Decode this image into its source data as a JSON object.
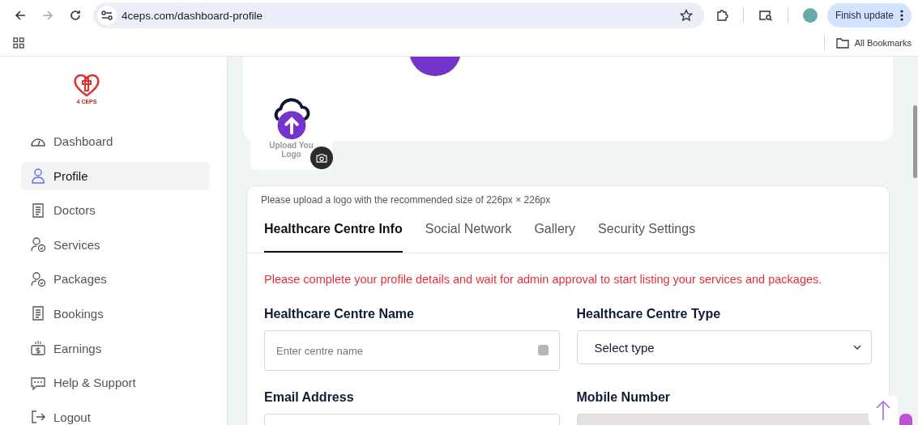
{
  "browser": {
    "url": "4ceps.com/dashboard-profile",
    "update_button": "Finish update",
    "bookmarks": "All Bookmarks"
  },
  "sidebar": {
    "logo_text": "4 CEPS",
    "items": [
      {
        "label": "Dashboard",
        "kind": "gauge",
        "selected": false
      },
      {
        "label": "Profile",
        "kind": "user",
        "selected": true
      },
      {
        "label": "Doctors",
        "kind": "doc",
        "selected": false
      },
      {
        "label": "Services",
        "kind": "usercheck",
        "selected": false
      },
      {
        "label": "Packages",
        "kind": "usercheck",
        "selected": false
      },
      {
        "label": "Bookings",
        "kind": "doc",
        "selected": false
      },
      {
        "label": "Earnings",
        "kind": "money",
        "selected": false
      },
      {
        "label": "Help & Support",
        "kind": "chat",
        "selected": false
      },
      {
        "label": "Logout",
        "kind": "logout",
        "selected": false
      }
    ]
  },
  "upload": {
    "label": "Upload You\nLogo"
  },
  "form": {
    "hint": "Please upload a logo with the recommended size of 226px × 226px",
    "tabs": [
      {
        "label": "Healthcare Centre Info",
        "selected": true
      },
      {
        "label": "Social Network",
        "selected": false
      },
      {
        "label": "Gallery",
        "selected": false
      },
      {
        "label": "Security Settings",
        "selected": false
      }
    ],
    "notice": "Please complete your profile details and wait for admin approval to start listing your services and packages.",
    "fields": [
      {
        "label": "Healthcare Centre Name",
        "kind": "text",
        "placeholder": "Enter centre name",
        "disabled": false
      },
      {
        "label": "Healthcare Centre Type",
        "kind": "select",
        "value": "Select type",
        "disabled": false
      },
      {
        "label": "Email Address",
        "kind": "text",
        "disabled": false
      },
      {
        "label": "Mobile Number",
        "kind": "text",
        "disabled": true
      }
    ]
  }
}
